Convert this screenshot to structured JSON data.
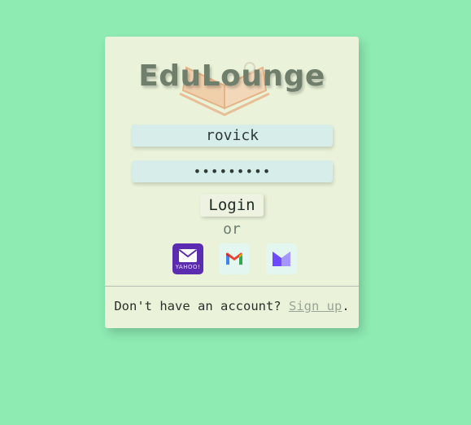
{
  "app": {
    "title": "EduLounge"
  },
  "login": {
    "username_value": "rovick",
    "password_value": "•••••••••",
    "login_label": "Login",
    "or_label": "or"
  },
  "social": {
    "yahoo_text": "YAHOO!",
    "items": [
      {
        "name": "yahoo-mail",
        "icon": "envelope-icon",
        "color": "#5b2bb0"
      },
      {
        "name": "gmail",
        "icon": "gmail-icon",
        "color": "#e4f6f0"
      },
      {
        "name": "proton-mail",
        "icon": "proton-icon",
        "color": "#e4f6f0"
      }
    ]
  },
  "footer": {
    "prompt": "Don't have an account? ",
    "signup_label": "Sign up",
    "suffix": "."
  },
  "colors": {
    "background": "#8eebb2",
    "card": "#eaf3d9",
    "field": "#d7ede9",
    "title": "#6f7f6c",
    "link": "#98a497"
  }
}
